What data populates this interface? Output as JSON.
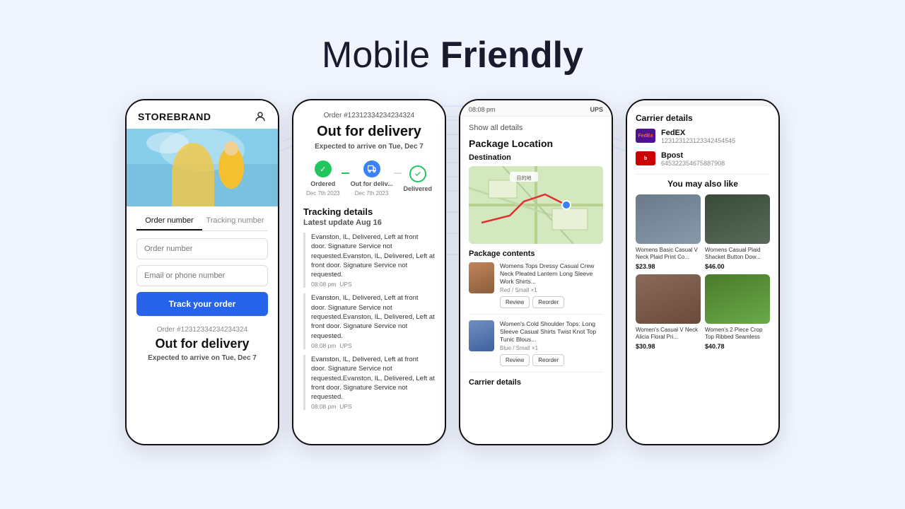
{
  "page": {
    "title_normal": "Mobile ",
    "title_bold": "Friendly",
    "bg_color": "#eef2ff"
  },
  "phone1": {
    "brand": "STOREBRAND",
    "tabs": [
      "Order number",
      "Tracking number"
    ],
    "input_order_placeholder": "Order number",
    "input_contact_placeholder": "Email or phone number",
    "button_label": "Track your order",
    "order_id_label": "Order #12312334234234324",
    "status": "Out for delivery",
    "eta_prefix": "Expected to arrive on ",
    "eta_date": "Tue, Dec 7"
  },
  "phone2": {
    "order_id": "Order #12312334234234324",
    "status": "Out for delivery",
    "eta_prefix": "Expected to arrive on ",
    "eta_date": "Tue, Dec 7",
    "steps": [
      {
        "label": "Ordered",
        "date": "Dec 7th 2023",
        "state": "done"
      },
      {
        "label": "Out for deliv...",
        "date": "Dec 7th 2023",
        "state": "active"
      },
      {
        "label": "Delivered",
        "date": "",
        "state": "pending"
      }
    ],
    "tracking_header": "Tracking details",
    "latest_update": "Latest update Aug 16",
    "events": [
      {
        "text": "Evanston, IL, Delivered, Left at front door. Signature Service not requested.Evanston, IL, Delivered, Left at front door. Signature Service not requested.",
        "time": "08:08 pm",
        "carrier": "UPS"
      },
      {
        "text": "Evanston, IL, Delivered, Left at front door. Signature Service not requested.Evanston, IL, Delivered, Left at front door. Signature Service not requested.",
        "time": "08:08 pm",
        "carrier": "UPS"
      },
      {
        "text": "Evanston, IL, Delivered, Left at front door. Signature Service not requested.Evanston, IL, Delivered, Left at front door. Signature Service not requested.",
        "time": "08:08 pm",
        "carrier": "UPS"
      }
    ]
  },
  "phone3": {
    "topbar_time": "08:08 pm",
    "topbar_carrier": "UPS",
    "show_all": "Show all details",
    "pkg_location": "Package Location",
    "destination": "Destination",
    "pkg_contents": "Package contents",
    "items": [
      {
        "name": "Womens Tops Dressy Casual Crew Neck Pleated Lantern Long Sleeve Work Shirts...",
        "variant": "Red / Small  ×1",
        "btn1": "Review",
        "btn2": "Reorder"
      },
      {
        "name": "Women's Cold Shoulder Tops: Long Sleeve Casual Shirts Twist Knot Top Tunic Blous...",
        "variant": "Blue / Small  ×1",
        "btn1": "Review",
        "btn2": "Reorder"
      }
    ],
    "carrier_label": "Carrier details"
  },
  "phone4": {
    "carrier_details_title": "Carrier details",
    "carriers": [
      {
        "name": "FedEX",
        "logo_text": "FedEx",
        "tracking": "123123123123342454545",
        "type": "fedex"
      },
      {
        "name": "Bpost",
        "logo_text": "b",
        "tracking": "645322354675887908",
        "type": "bpost"
      }
    ],
    "recommendations_title": "You may also like",
    "products": [
      {
        "name": "Womens Basic Casual V Neck Plaid Print Co...",
        "price": "$23.98",
        "img_class": "prod-1"
      },
      {
        "name": "Womens Casual Plaid Shacket Button Dow...",
        "price": "$46.00",
        "img_class": "prod-2"
      },
      {
        "name": "Women's Casual V Neck Alicia Floral Pri...",
        "price": "$30.98",
        "img_class": "prod-3"
      },
      {
        "name": "Women's 2 Piece Crop Top Ribbed Seamless",
        "price": "$40.78",
        "img_class": "prod-4"
      }
    ]
  }
}
